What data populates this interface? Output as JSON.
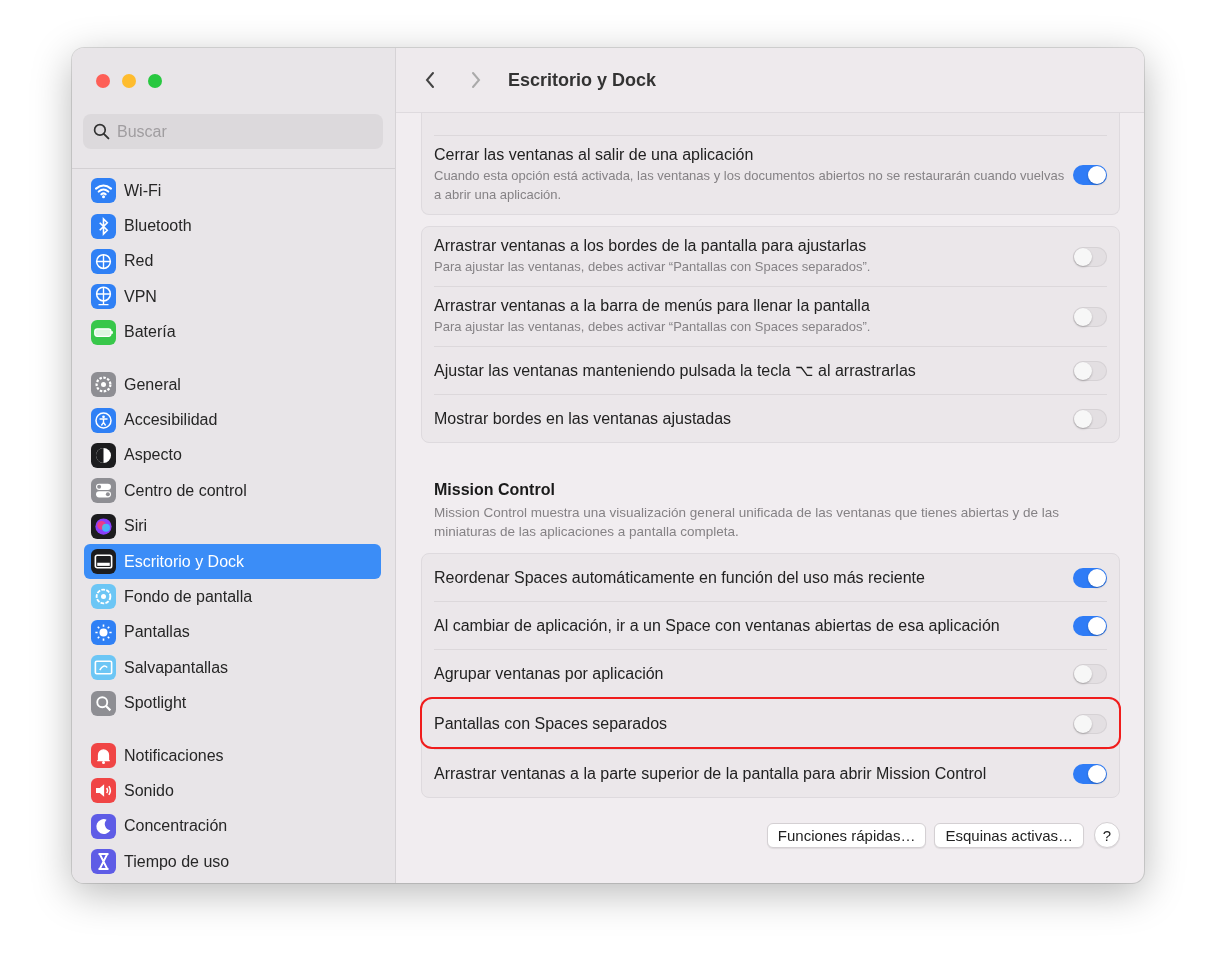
{
  "window": {
    "title": "Escritorio y Dock"
  },
  "search": {
    "placeholder": "Buscar"
  },
  "sidebar": {
    "groups": [
      {
        "items": [
          {
            "label": "Wi-Fi",
            "selected": false
          },
          {
            "label": "Bluetooth",
            "selected": false
          },
          {
            "label": "Red",
            "selected": false
          },
          {
            "label": "VPN",
            "selected": false
          },
          {
            "label": "Batería",
            "selected": false
          }
        ]
      },
      {
        "items": [
          {
            "label": "General",
            "selected": false
          },
          {
            "label": "Accesibilidad",
            "selected": false
          },
          {
            "label": "Aspecto",
            "selected": false
          },
          {
            "label": "Centro de control",
            "selected": false
          },
          {
            "label": "Siri",
            "selected": false
          },
          {
            "label": "Escritorio y Dock",
            "selected": true
          },
          {
            "label": "Fondo de pantalla",
            "selected": false
          },
          {
            "label": "Pantallas",
            "selected": false
          },
          {
            "label": "Salvapantallas",
            "selected": false
          },
          {
            "label": "Spotlight",
            "selected": false
          }
        ]
      },
      {
        "items": [
          {
            "label": "Notificaciones",
            "selected": false
          },
          {
            "label": "Sonido",
            "selected": false
          },
          {
            "label": "Concentración",
            "selected": false
          },
          {
            "label": "Tiempo de uso",
            "selected": false
          }
        ]
      }
    ]
  },
  "sections": [
    {
      "cards": [
        {
          "rows": [
            {
              "title": "Cerrar las ventanas al salir de una aplicación",
              "description": "Cuando esta opción está activada, las ventanas y los documentos abiertos no se restaurarán cuando vuelvas a abrir una aplicación.",
              "on": true,
              "highlighted": false
            }
          ]
        },
        {
          "rows": [
            {
              "title": "Arrastrar ventanas a los bordes de la pantalla para ajustarlas",
              "description": "Para ajustar las ventanas, debes activar “Pantallas con Spaces separados”.",
              "on": false,
              "highlighted": false
            },
            {
              "title": "Arrastrar ventanas a la barra de menús para llenar la pantalla",
              "description": "Para ajustar las ventanas, debes activar “Pantallas con Spaces separados”.",
              "on": false,
              "highlighted": false
            },
            {
              "title": "Ajustar las ventanas manteniendo pulsada la tecla ⌥ al arrastrarlas",
              "on": false,
              "highlighted": false
            },
            {
              "title": "Mostrar bordes en las ventanas ajustadas",
              "on": false,
              "highlighted": false
            }
          ]
        }
      ]
    },
    {
      "title": "Mission Control",
      "description": "Mission Control muestra una visualización general unificada de las ventanas que tienes abiertas y de las miniaturas de las aplicaciones a pantalla completa.",
      "cards": [
        {
          "rows": [
            {
              "title": "Reordenar Spaces automáticamente en función del uso más reciente",
              "on": true,
              "highlighted": false
            },
            {
              "title": "Al cambiar de aplicación, ir a un Space con ventanas abiertas de esa aplicación",
              "on": true,
              "highlighted": false
            },
            {
              "title": "Agrupar ventanas por aplicación",
              "on": false,
              "highlighted": false
            },
            {
              "title": "Pantallas con Spaces separados",
              "on": false,
              "highlighted": true
            },
            {
              "title": "Arrastrar ventanas a la parte superior de la pantalla para abrir Mission Control",
              "on": true,
              "highlighted": false
            }
          ]
        }
      ]
    }
  ],
  "buttons": [
    "Funciones rápidas…",
    "Esquinas activas…"
  ],
  "help": "?"
}
